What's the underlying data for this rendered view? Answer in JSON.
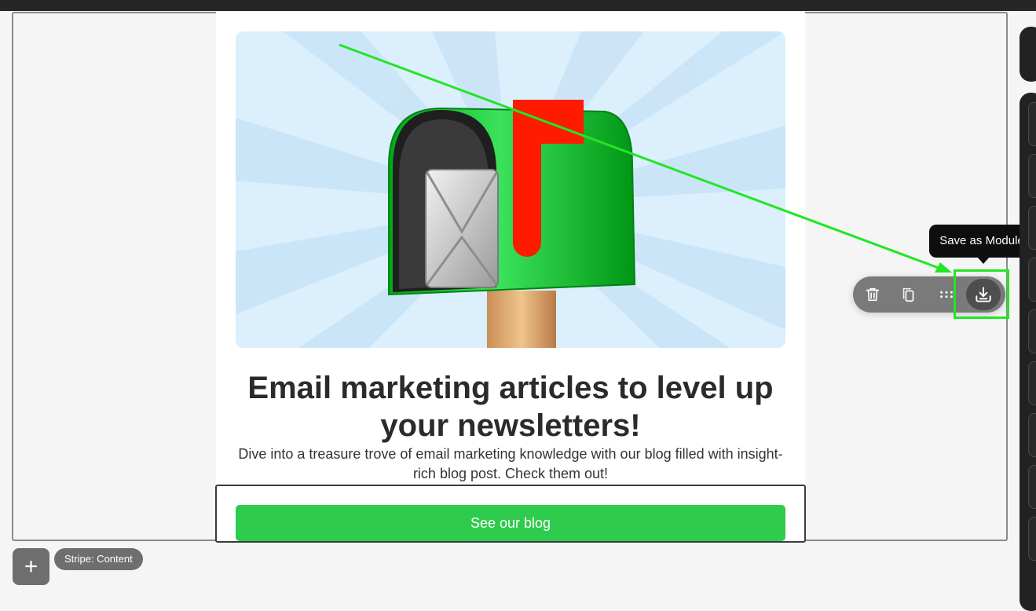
{
  "headline": "Email marketing articles to level up your newsletters!",
  "subtext": "Dive into a treasure trove of email marketing knowledge with our blog filled with insight-rich blog post. Check them out!",
  "cta_label": "See our blog",
  "tooltip": "Save as Module",
  "stripe_label": "Stripe: Content",
  "add_label": "+",
  "toolbar": [
    "trash-icon",
    "duplicate-icon",
    "drag-handle-icon",
    "save-module-icon"
  ],
  "colors": {
    "cta": "#2fcb4d",
    "highlight": "#22e622",
    "toolbar": "#7a7a7a",
    "tooltip": "#0e0e0e",
    "hero_bg": "#dbeffc",
    "mailbox": "#06b61f",
    "flag": "#ff1a00"
  }
}
